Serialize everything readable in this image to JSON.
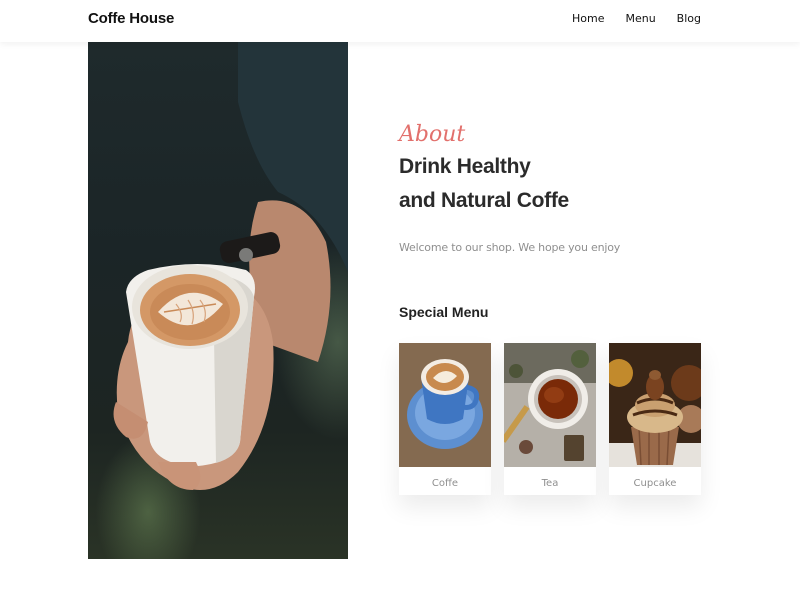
{
  "header": {
    "logo": "Coffe House",
    "nav": [
      {
        "label": "Home"
      },
      {
        "label": "Menu"
      },
      {
        "label": "Blog"
      }
    ]
  },
  "about": {
    "script_label": "About",
    "title_line1": "Drink Healthy",
    "title_line2": "and Natural Coffe",
    "description": "Welcome to our shop. We hope you enjoy"
  },
  "special_menu": {
    "title": "Special Menu",
    "items": [
      {
        "label": "Coffe"
      },
      {
        "label": "Tea"
      },
      {
        "label": "Cupcake"
      }
    ]
  },
  "colors": {
    "accent": "#e2706c",
    "heading": "#2b2b2b",
    "muted": "#8f8f8f"
  }
}
